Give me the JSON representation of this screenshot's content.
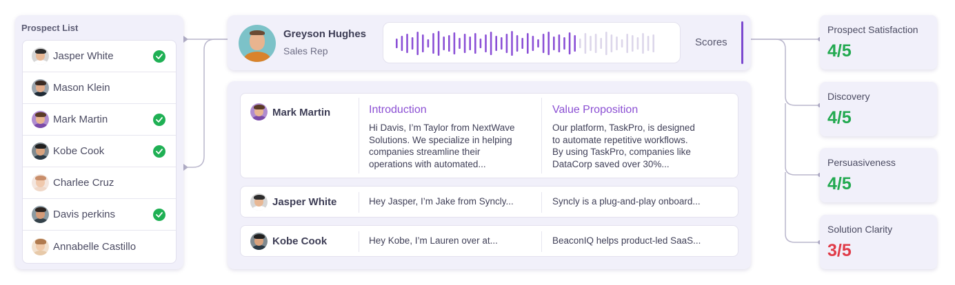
{
  "prospect_list": {
    "title": "Prospect List",
    "items": [
      {
        "name": "Jasper White",
        "checked": true,
        "avatar": {
          "bg": "#d6d6d6",
          "hair": "#2c2c2c",
          "body": "#ffffff",
          "skin": "#e8b895"
        }
      },
      {
        "name": "Mason Klein",
        "checked": false,
        "avatar": {
          "bg": "#9aa4ad",
          "hair": "#3a2a22",
          "body": "#1e2a35",
          "skin": "#e3ac8b"
        }
      },
      {
        "name": "Mark Martin",
        "checked": true,
        "avatar": {
          "bg": "#b08ccf",
          "hair": "#5a3a26",
          "body": "#7b4aa8",
          "skin": "#e9b591"
        }
      },
      {
        "name": "Kobe Cook",
        "checked": true,
        "avatar": {
          "bg": "#7f8a90",
          "hair": "#1f1f1f",
          "body": "#2b3a45",
          "skin": "#d9a37e"
        }
      },
      {
        "name": "Charlee Cruz",
        "checked": false,
        "avatar": {
          "bg": "#f3e6df",
          "hair": "#c98e6a",
          "body": "#f0d8c8",
          "skin": "#f0c9ad"
        }
      },
      {
        "name": "Davis perkins",
        "checked": true,
        "avatar": {
          "bg": "#8a9aa2",
          "hair": "#2c2420",
          "body": "#34424a",
          "skin": "#d49b78"
        }
      },
      {
        "name": "Annabelle Castillo",
        "checked": false,
        "avatar": {
          "bg": "#f2e1cf",
          "hair": "#b07a4e",
          "body": "#e7c9a8",
          "skin": "#f1caa9"
        }
      }
    ]
  },
  "rep": {
    "name": "Greyson Hughes",
    "role": "Sales Rep"
  },
  "waveform": {
    "played_color": "#8a4fd6",
    "unplayed_color": "#dcd6ea",
    "played_fraction": 0.69
  },
  "scores_label": "Scores",
  "calls": [
    {
      "name": "Mark Martin",
      "avatar": {
        "bg": "#b08ccf",
        "hair": "#5a3a26",
        "body": "#7b4aa8",
        "skin": "#e9b591"
      },
      "introduction_title": "Introduction",
      "introduction_lines": [
        "Hi Davis, I’m Taylor from NextWave",
        "Solutions. We specialize in helping",
        "companies streamline their",
        "operations with automated..."
      ],
      "value_title": "Value Proposition",
      "value_lines": [
        "Our platform, TaskPro, is designed",
        "to automate repetitive workflows.",
        "By using TaskPro, companies like",
        "DataCorp saved over 30%..."
      ]
    },
    {
      "name": "Jasper White",
      "avatar": {
        "bg": "#d6d6d6",
        "hair": "#2c2c2c",
        "body": "#ffffff",
        "skin": "#e8b895"
      },
      "introduction": "Hey Jasper, I’m Jake from Syncly...",
      "value": "Syncly is a plug-and-play onboard..."
    },
    {
      "name": "Kobe Cook",
      "avatar": {
        "bg": "#7f8a90",
        "hair": "#1f1f1f",
        "body": "#2b3a45",
        "skin": "#d9a37e"
      },
      "introduction": "Hey Kobe, I’m Lauren over at...",
      "value": "BeaconIQ helps product-led SaaS..."
    }
  ],
  "scores": [
    {
      "title": "Prospect Satisfaction",
      "value": "4/5",
      "color": "#22a950"
    },
    {
      "title": "Discovery",
      "value": "4/5",
      "color": "#22a950"
    },
    {
      "title": "Persuasiveness",
      "value": "4/5",
      "color": "#22a950"
    },
    {
      "title": "Solution Clarity",
      "value": "3/5",
      "color": "#e03b48"
    }
  ],
  "colors": {
    "accent": "#8b4fd3",
    "connector": "#b9b6cc",
    "check": "#1fb054"
  }
}
